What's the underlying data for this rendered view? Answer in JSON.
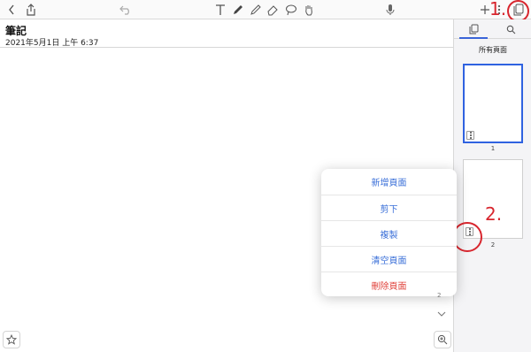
{
  "toolbar": {
    "icons": [
      "back-icon",
      "share-icon",
      "undo-icon",
      "text-tool-icon",
      "pen-icon",
      "highlighter-icon",
      "eraser-icon",
      "lasso-icon",
      "hand-icon",
      "mic-icon",
      "add-icon",
      "more-icon",
      "pages-icon"
    ]
  },
  "note": {
    "title": "筆記",
    "date": "2021年5月1日 上午 6:37"
  },
  "panel": {
    "heading": "所有頁面",
    "thumbnails": [
      {
        "number": "1",
        "selected": true
      },
      {
        "number": "2",
        "selected": false
      }
    ]
  },
  "menu": {
    "items": [
      {
        "label": "新增頁面",
        "danger": false
      },
      {
        "label": "剪下",
        "danger": false
      },
      {
        "label": "複製",
        "danger": false
      },
      {
        "label": "清空頁面",
        "danger": false
      },
      {
        "label": "刪除頁面",
        "danger": true
      }
    ]
  },
  "annotations": {
    "step1": "1.",
    "step2": "2."
  },
  "scroll": {
    "page_indicator": "2"
  },
  "colors": {
    "accent": "#3a6fd8",
    "danger": "#e0433c",
    "annotation": "#d8262e",
    "selected_border": "#2f62e0"
  }
}
